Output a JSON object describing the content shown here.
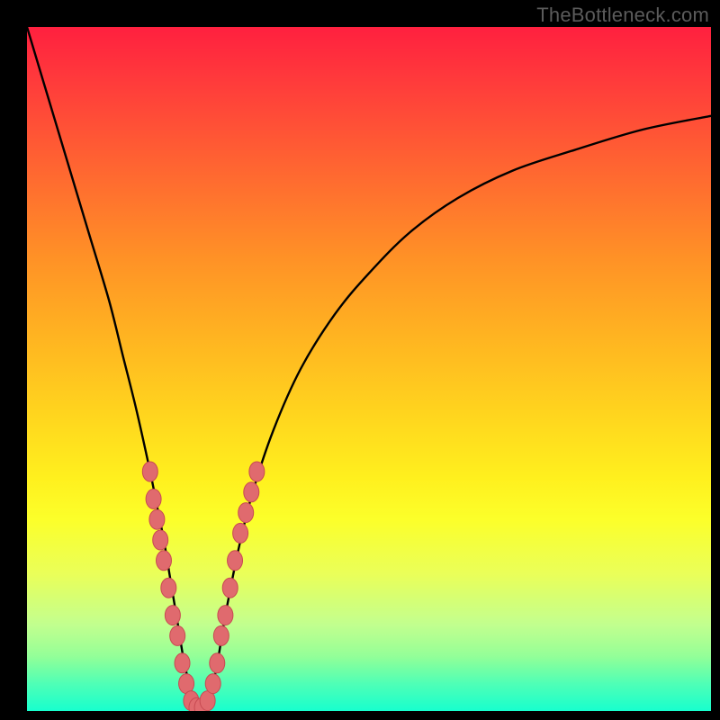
{
  "watermark": "TheBottleneck.com",
  "colors": {
    "background": "#000000",
    "curve": "#000000",
    "marker_fill": "#e06a6e",
    "marker_stroke": "#c84a52",
    "gradient_top": "#ff203f",
    "gradient_bottom": "#17ffce"
  },
  "chart_data": {
    "type": "line",
    "title": "",
    "xlabel": "",
    "ylabel": "",
    "xlim": [
      0,
      100
    ],
    "ylim": [
      0,
      100
    ],
    "grid": false,
    "legend": false,
    "series": [
      {
        "name": "bottleneck-curve",
        "x": [
          0,
          3,
          6,
          9,
          12,
          14,
          16,
          18,
          19,
          20,
          21,
          22,
          23,
          24,
          25,
          26,
          27,
          28,
          29,
          31,
          33,
          36,
          40,
          45,
          50,
          56,
          63,
          71,
          80,
          90,
          100
        ],
        "y": [
          100,
          90,
          80,
          70,
          60,
          52,
          44,
          35,
          30,
          25,
          19,
          13,
          7,
          3,
          0,
          0,
          3,
          8,
          14,
          24,
          32,
          41,
          50,
          58,
          64,
          70,
          75,
          79,
          82,
          85,
          87
        ]
      }
    ],
    "markers": {
      "name": "highlighted-points",
      "points": [
        {
          "x": 18.0,
          "y": 35
        },
        {
          "x": 18.5,
          "y": 31
        },
        {
          "x": 19.0,
          "y": 28
        },
        {
          "x": 19.5,
          "y": 25
        },
        {
          "x": 20.0,
          "y": 22
        },
        {
          "x": 20.7,
          "y": 18
        },
        {
          "x": 21.3,
          "y": 14
        },
        {
          "x": 22.0,
          "y": 11
        },
        {
          "x": 22.7,
          "y": 7
        },
        {
          "x": 23.3,
          "y": 4
        },
        {
          "x": 24.0,
          "y": 1.5
        },
        {
          "x": 24.8,
          "y": 0.5
        },
        {
          "x": 25.6,
          "y": 0.5
        },
        {
          "x": 26.4,
          "y": 1.5
        },
        {
          "x": 27.2,
          "y": 4
        },
        {
          "x": 27.8,
          "y": 7
        },
        {
          "x": 28.4,
          "y": 11
        },
        {
          "x": 29.0,
          "y": 14
        },
        {
          "x": 29.7,
          "y": 18
        },
        {
          "x": 30.4,
          "y": 22
        },
        {
          "x": 31.2,
          "y": 26
        },
        {
          "x": 32.0,
          "y": 29
        },
        {
          "x": 32.8,
          "y": 32
        },
        {
          "x": 33.6,
          "y": 35
        }
      ]
    }
  }
}
